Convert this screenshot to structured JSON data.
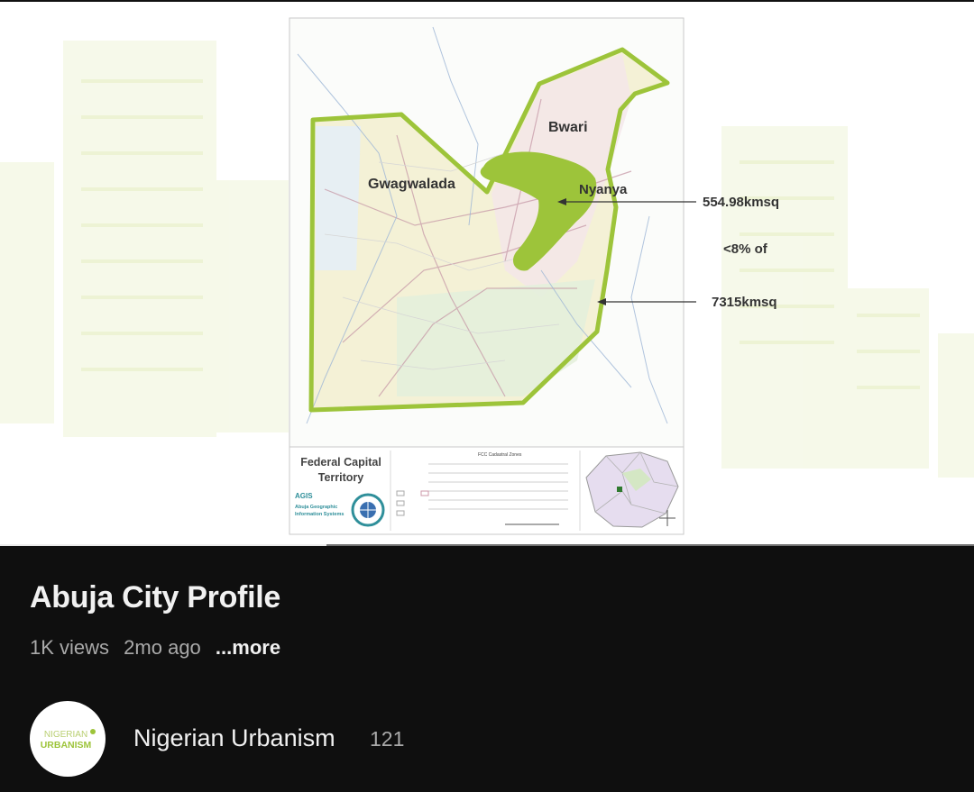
{
  "video": {
    "progress": 0.335,
    "map": {
      "labels": {
        "bwari": "Bwari",
        "gwagwalada": "Gwagwalada",
        "nyanya": "Nyanya"
      },
      "annotations": {
        "city_area": "554.98kmsq",
        "ratio": "<8% of",
        "territory_area": "7315kmsq"
      },
      "legend": {
        "title_line1": "Federal Capital",
        "title_line2": "Territory",
        "agis_logo": "AGIS",
        "agis_line1": "Abuja Geographic",
        "agis_line2": "Information Systems",
        "zones_heading": "FCC Cadastral Zones"
      },
      "colors": {
        "boundary": "#9dc43a",
        "city_fill": "#9dc43a",
        "annotation_text": "#333333"
      }
    }
  },
  "title": "Abuja City Profile",
  "meta": {
    "views": "1K views",
    "age": "2mo ago",
    "more": "...more"
  },
  "channel": {
    "avatar_line1": "NIGERIAN",
    "avatar_line2": "URBANISM",
    "name": "Nigerian Urbanism",
    "subscribers": "121"
  }
}
